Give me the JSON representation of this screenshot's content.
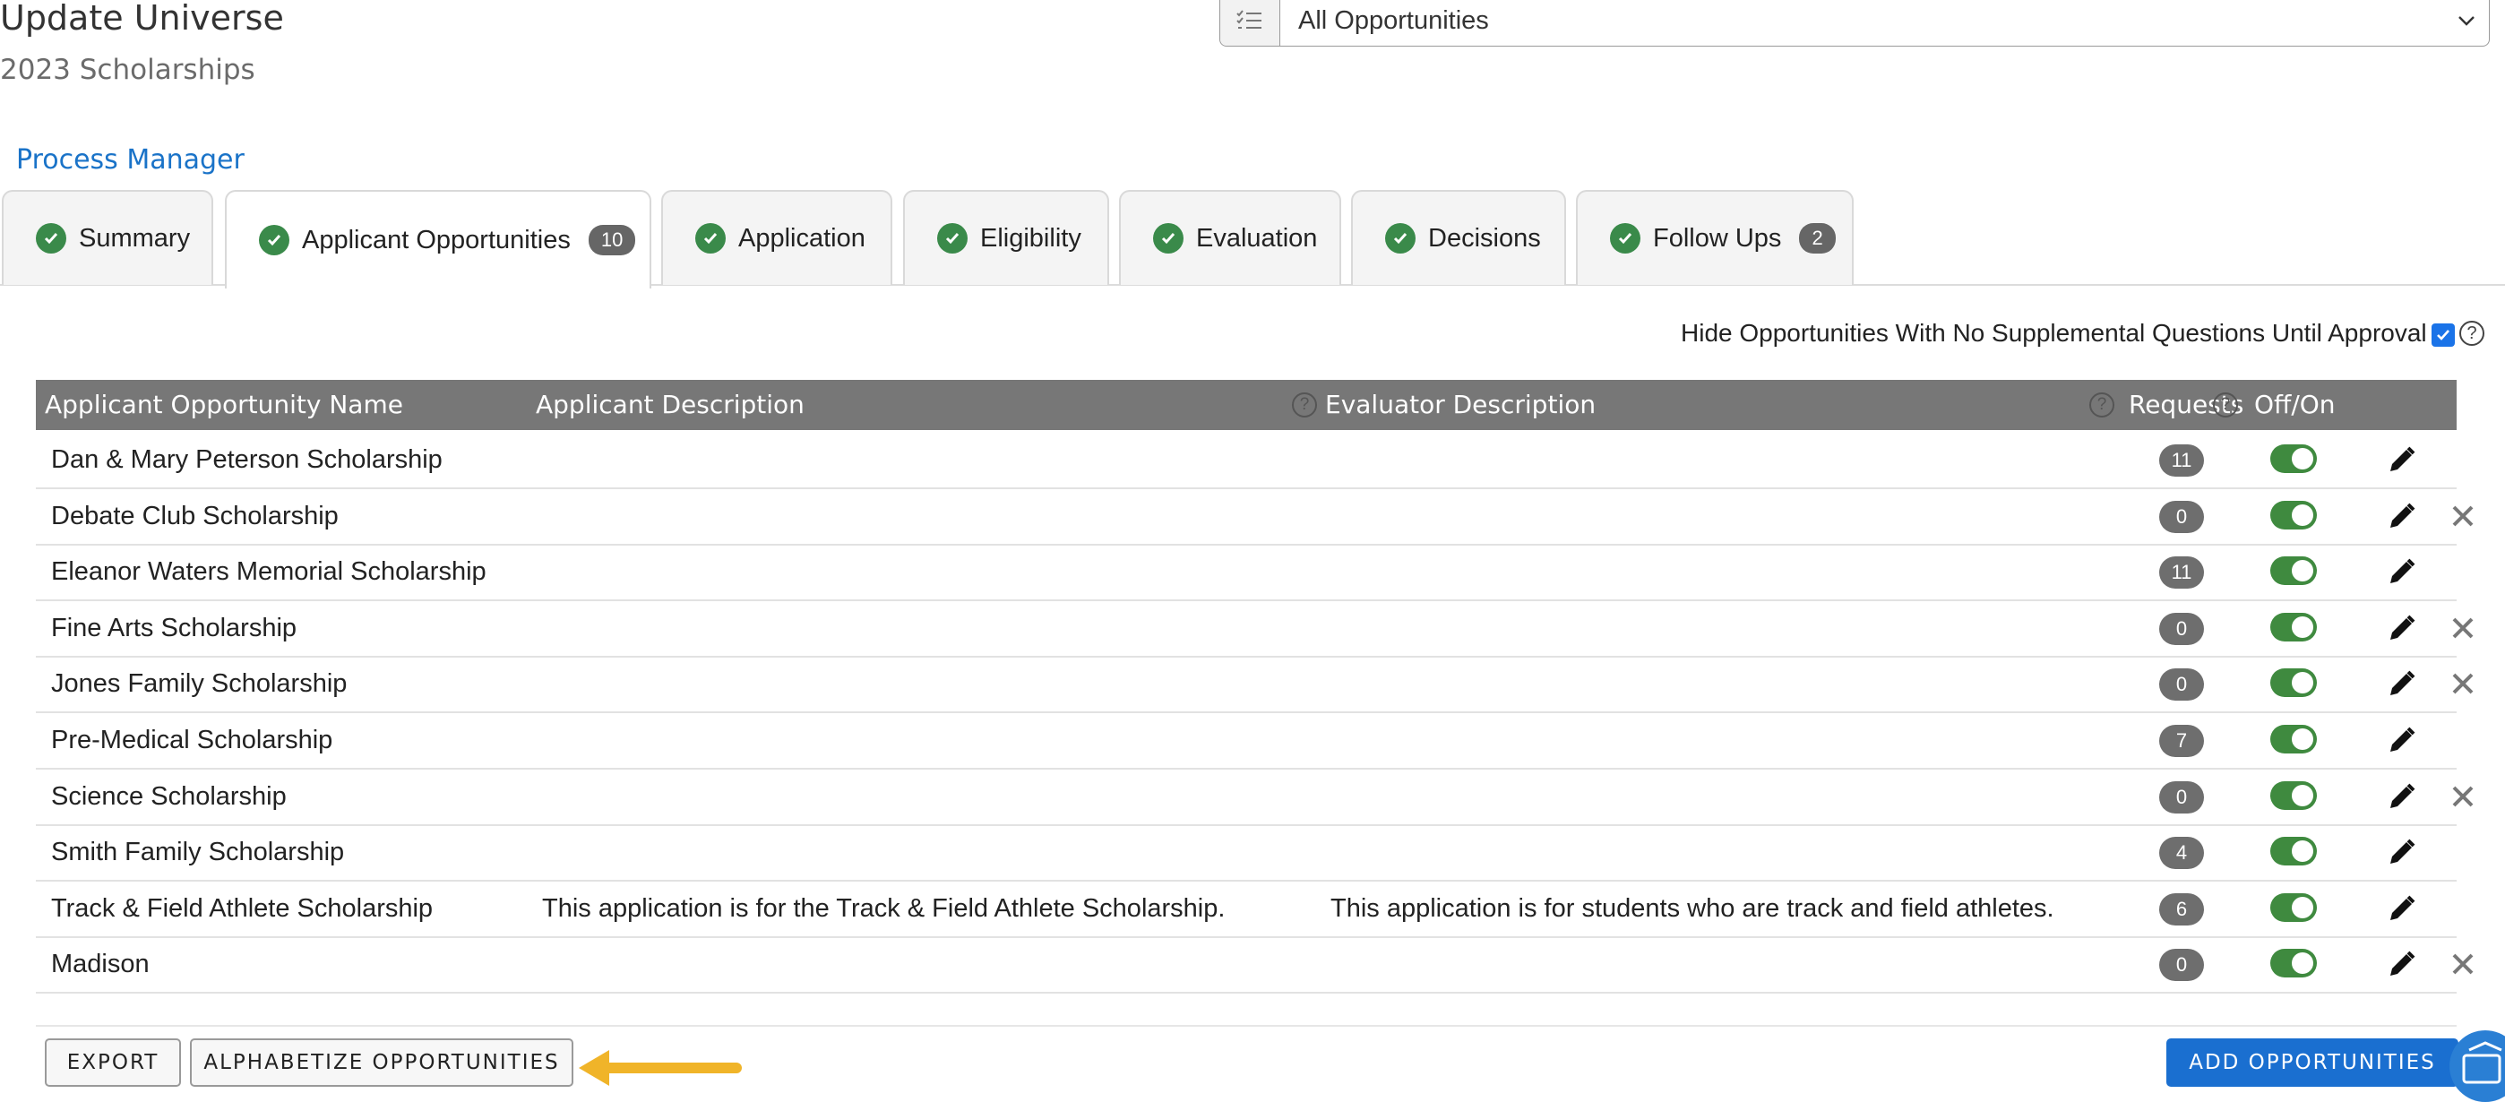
{
  "header": {
    "title": "Update Universe",
    "subtitle": "2023 Scholarships",
    "filter_value": "All Opportunities"
  },
  "process_link": "Process Manager",
  "tabs": [
    {
      "label": "Summary",
      "badge": ""
    },
    {
      "label": "Applicant Opportunities",
      "badge": "10"
    },
    {
      "label": "Application",
      "badge": ""
    },
    {
      "label": "Eligibility",
      "badge": ""
    },
    {
      "label": "Evaluation",
      "badge": ""
    },
    {
      "label": "Decisions",
      "badge": ""
    },
    {
      "label": "Follow Ups",
      "badge": "2"
    }
  ],
  "hide_option": {
    "label": "Hide Opportunities With No Supplemental Questions Until Approval",
    "checked": true
  },
  "table": {
    "columns": {
      "name": "Applicant Opportunity Name",
      "applicant_desc": "Applicant Description",
      "evaluator_desc": "Evaluator Description",
      "requests": "Requests",
      "offon": "Off/On"
    },
    "rows": [
      {
        "name": "Dan & Mary Peterson Scholarship",
        "applicant_desc": "",
        "evaluator_desc": "",
        "requests": "11",
        "on": true,
        "deletable": false
      },
      {
        "name": "Debate Club Scholarship",
        "applicant_desc": "",
        "evaluator_desc": "",
        "requests": "0",
        "on": true,
        "deletable": true
      },
      {
        "name": "Eleanor Waters Memorial Scholarship",
        "applicant_desc": "",
        "evaluator_desc": "",
        "requests": "11",
        "on": true,
        "deletable": false
      },
      {
        "name": "Fine Arts Scholarship",
        "applicant_desc": "",
        "evaluator_desc": "",
        "requests": "0",
        "on": true,
        "deletable": true
      },
      {
        "name": "Jones Family Scholarship",
        "applicant_desc": "",
        "evaluator_desc": "",
        "requests": "0",
        "on": true,
        "deletable": true
      },
      {
        "name": "Pre-Medical Scholarship",
        "applicant_desc": "",
        "evaluator_desc": "",
        "requests": "7",
        "on": true,
        "deletable": false
      },
      {
        "name": "Science Scholarship",
        "applicant_desc": "",
        "evaluator_desc": "",
        "requests": "0",
        "on": true,
        "deletable": true
      },
      {
        "name": "Smith Family Scholarship",
        "applicant_desc": "",
        "evaluator_desc": "",
        "requests": "4",
        "on": true,
        "deletable": false
      },
      {
        "name": "Track & Field Athlete Scholarship",
        "applicant_desc": "This application is for the Track & Field Athlete Scholarship.",
        "evaluator_desc": "This application is for students who are track and field athletes.",
        "requests": "6",
        "on": true,
        "deletable": false
      },
      {
        "name": "Madison",
        "applicant_desc": "",
        "evaluator_desc": "",
        "requests": "0",
        "on": true,
        "deletable": true
      }
    ]
  },
  "footer": {
    "export_label": "EXPORT",
    "alphabetize_label": "ALPHABETIZE OPPORTUNITIES",
    "add_label": "ADD OPPORTUNITIES"
  },
  "colors": {
    "accent": "#1a6fd0",
    "success": "#3a8a4a",
    "header_bg": "#777777",
    "arrow": "#f0b429"
  },
  "icons": {
    "filter": "list-check-icon",
    "check": "check-circle-icon",
    "help": "question-circle-icon",
    "edit": "pencil-icon",
    "delete": "x-icon",
    "arrow": "left-arrow-icon",
    "chat": "chat-launcher-icon"
  }
}
